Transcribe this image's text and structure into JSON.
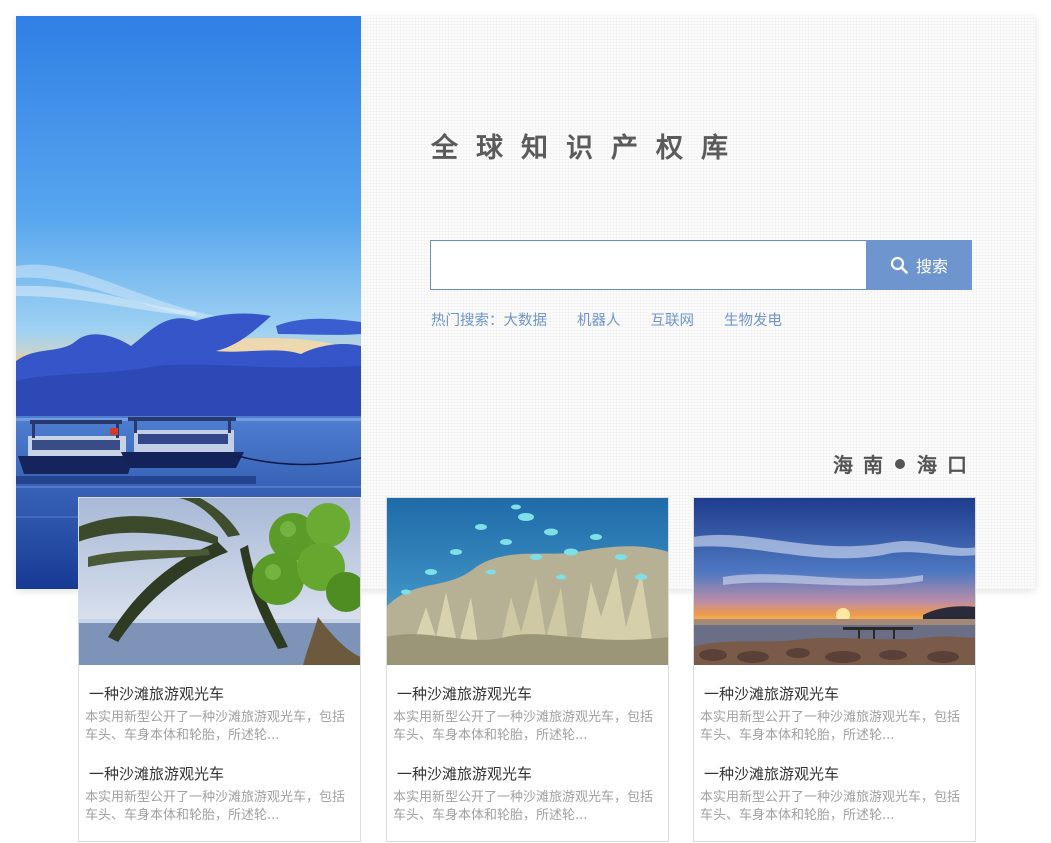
{
  "header": {
    "title": "全球知识产权库"
  },
  "search": {
    "value": "",
    "placeholder": "",
    "button_label": "搜索"
  },
  "hot_search": {
    "label": "热门搜索：",
    "terms": [
      "大数据",
      "机器人",
      "互联网",
      "生物发电"
    ]
  },
  "location": {
    "province": "海南",
    "city": "海口"
  },
  "colors": {
    "accent": "#6f95cf",
    "title": "#5b5b5b",
    "muted": "#a0a0a0"
  },
  "cards": [
    {
      "image": "coconut-palm-beach-photo",
      "items": [
        {
          "title": "一种沙滩旅游观光车",
          "desc": "本实用新型公开了一种沙滩旅游观光车，包括车头、车身本体和轮胎，所述轮..."
        },
        {
          "title": "一种沙滩旅游观光车",
          "desc": "本实用新型公开了一种沙滩旅游观光车，包括车头、车身本体和轮胎，所述轮..."
        }
      ]
    },
    {
      "image": "coral-reef-fish-photo",
      "items": [
        {
          "title": "一种沙滩旅游观光车",
          "desc": "本实用新型公开了一种沙滩旅游观光车，包括车头、车身本体和轮胎，所述轮..."
        },
        {
          "title": "一种沙滩旅游观光车",
          "desc": "本实用新型公开了一种沙滩旅游观光车，包括车头、车身本体和轮胎，所述轮..."
        }
      ]
    },
    {
      "image": "sunset-rocky-shore-photo",
      "items": [
        {
          "title": "一种沙滩旅游观光车",
          "desc": "本实用新型公开了一种沙滩旅游观光车，包括车头、车身本体和轮胎，所述轮..."
        },
        {
          "title": "一种沙滩旅游观光车",
          "desc": "本实用新型公开了一种沙滩旅游观光车，包括车头、车身本体和轮胎，所述轮..."
        }
      ]
    }
  ]
}
